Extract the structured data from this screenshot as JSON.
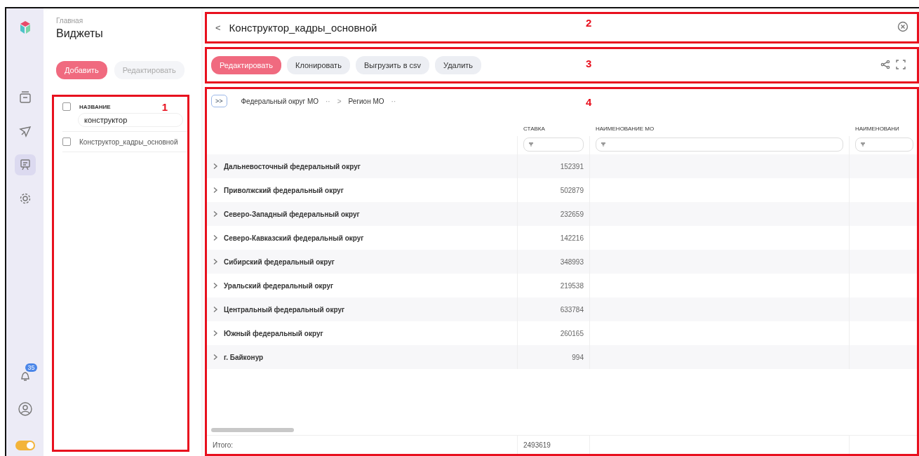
{
  "sidebar": {
    "nav": [
      {
        "kind": "logo",
        "selected": false
      },
      {
        "kind": "box",
        "selected": false
      },
      {
        "kind": "plane",
        "selected": false
      },
      {
        "kind": "board",
        "selected": true
      },
      {
        "kind": "gear",
        "selected": false
      }
    ],
    "notifications": {
      "count": "35"
    },
    "theme_toggle": {
      "on": true
    }
  },
  "widgets_panel": {
    "breadcrumb": "Главная",
    "title": "Виджеты",
    "buttons": [
      {
        "label": "Добавить",
        "disabled": false,
        "primary": true
      },
      {
        "label": "Редактировать",
        "disabled": true,
        "primary": false
      }
    ],
    "list": {
      "callout": "1",
      "column": "НАЗВАНИЕ",
      "all_checked": false,
      "filter": "конструктор",
      "rows": [
        {
          "name": "Конструктор_кадры_основной",
          "checked": false
        }
      ]
    }
  },
  "header": {
    "callout": "2",
    "back": "<",
    "title": "Конструктор_кадры_основной"
  },
  "toolbar": {
    "callout": "3",
    "buttons": [
      {
        "label": "Редактировать",
        "primary": true
      },
      {
        "label": "Клонировать",
        "primary": false
      },
      {
        "label": "Выгрузить в csv",
        "primary": false
      },
      {
        "label": "Удалить",
        "primary": false
      }
    ]
  },
  "table": {
    "callout": "4",
    "expand": ">>",
    "groupings": [
      "Федеральный округ МО",
      "Регион МО"
    ],
    "group_dots": "··",
    "group_sep": ">",
    "columns": [
      "СТАВКА",
      "НАИМЕНОВАНИЕ МО",
      "НАИМЕНОВАНИ"
    ],
    "rows": [
      {
        "name": "Дальневосточный федеральный округ",
        "value": "152391"
      },
      {
        "name": "Приволжский федеральный округ",
        "value": "502879"
      },
      {
        "name": "Северо-Западный федеральный округ",
        "value": "232659"
      },
      {
        "name": "Северо-Кавказский федеральный округ",
        "value": "142216"
      },
      {
        "name": "Сибирский федеральный округ",
        "value": "348993"
      },
      {
        "name": "Уральский федеральный округ",
        "value": "219538"
      },
      {
        "name": "Центральный федеральный округ",
        "value": "633784"
      },
      {
        "name": "Южный федеральный округ",
        "value": "260165"
      },
      {
        "name": "г. Байконур",
        "value": "994"
      }
    ],
    "footer": {
      "label": "Итого:",
      "total": "2493619"
    }
  }
}
